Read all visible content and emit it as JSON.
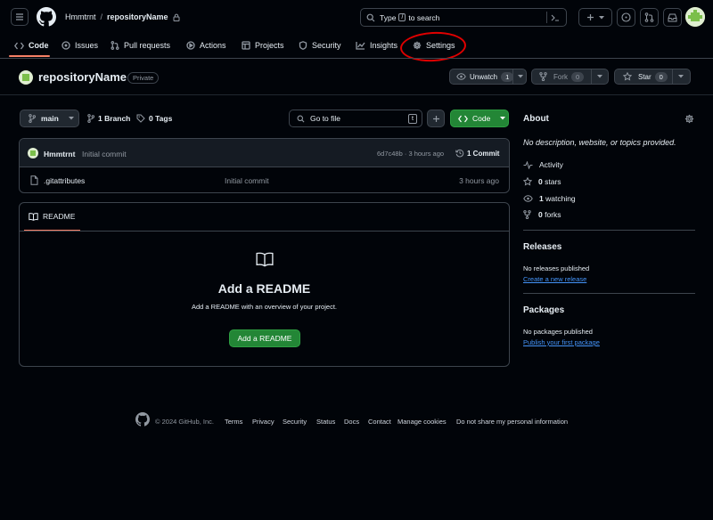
{
  "header": {
    "owner": "Hmmtrnt",
    "separator": "/",
    "repo": "repositoryName",
    "search_placeholder": "Type / to search",
    "search_prefix": "Type",
    "search_key": "/",
    "search_suffix": "to search"
  },
  "tabs": [
    {
      "label": "Code",
      "icon": "code-icon"
    },
    {
      "label": "Issues",
      "icon": "issue-icon"
    },
    {
      "label": "Pull requests",
      "icon": "pull-request-icon"
    },
    {
      "label": "Actions",
      "icon": "play-icon"
    },
    {
      "label": "Projects",
      "icon": "table-icon"
    },
    {
      "label": "Security",
      "icon": "shield-icon"
    },
    {
      "label": "Insights",
      "icon": "graph-icon"
    },
    {
      "label": "Settings",
      "icon": "gear-icon"
    }
  ],
  "repo_header": {
    "name": "repositoryName",
    "visibility": "Private",
    "unwatch_label": "Unwatch",
    "watch_count": "1",
    "fork_label": "Fork",
    "fork_count": "0",
    "star_label": "Star",
    "star_count": "0"
  },
  "toolbar": {
    "branch": "main",
    "branches": "1 Branch",
    "tags": "0 Tags",
    "goto_file": "Go to file",
    "goto_key": "t",
    "code_label": "Code"
  },
  "commit": {
    "author": "Hmmtrnt",
    "message": "Initial commit",
    "hash_time": "6d7c48b · 3 hours ago",
    "count": "1 Commit"
  },
  "files": [
    {
      "name": ".gitattributes",
      "message": "Initial commit",
      "time": "3 hours ago"
    }
  ],
  "readme": {
    "tab_label": "README",
    "title": "Add a README",
    "description": "Add a README with an overview of your project.",
    "button": "Add a README"
  },
  "about": {
    "title": "About",
    "description": "No description, website, or topics provided.",
    "activity": "Activity",
    "stars_count": "0",
    "stars_label": "stars",
    "watching_count": "1",
    "watching_label": "watching",
    "forks_count": "0",
    "forks_label": "forks"
  },
  "releases": {
    "title": "Releases",
    "empty": "No releases published",
    "link": "Create a new release"
  },
  "packages": {
    "title": "Packages",
    "empty": "No packages published",
    "link": "Publish your first package"
  },
  "footer": {
    "copyright": "© 2024 GitHub, Inc.",
    "links": [
      "Terms",
      "Privacy",
      "Security",
      "Status",
      "Docs",
      "Contact",
      "Manage cookies",
      "Do not share my personal information"
    ]
  },
  "colors": {
    "accent_underline": "#f78166",
    "green_button": "#238636",
    "link": "#4493f8",
    "annotation_red": "#e00000"
  }
}
